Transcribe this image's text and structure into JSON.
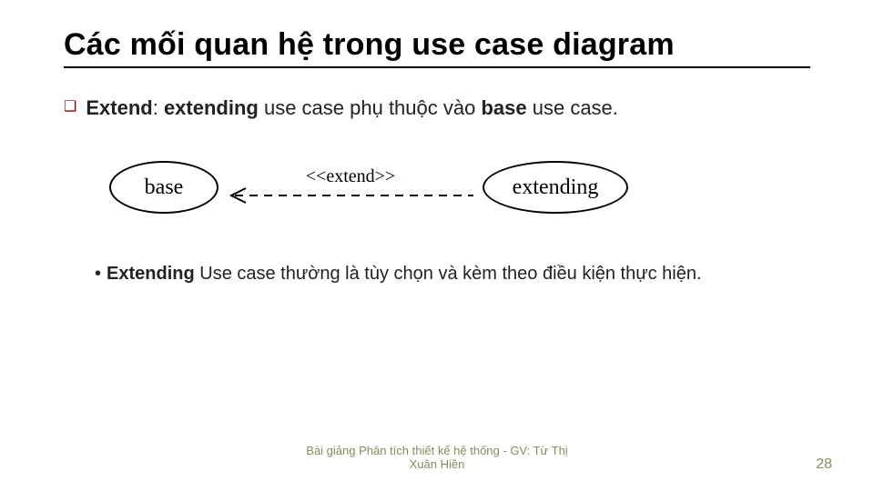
{
  "title": "Các mối quan hệ trong use case diagram",
  "bullet": {
    "marker": "❑",
    "keyword1": "Extend",
    "colon": ": ",
    "keyword2": "extending",
    "rest": " use case phụ thuộc vào ",
    "keyword3": "base",
    "tail": " use case."
  },
  "diagram": {
    "left": "base",
    "label": "<<extend>>",
    "right": "extending"
  },
  "subbullet": {
    "dot": "•",
    "keyword": "Extending",
    "rest": " Use case thường là tùy chọn và kèm theo điều kiện thực hiện."
  },
  "footer": {
    "text": "Bài giảng Phân tích thiết kế hệ thống - GV: Từ Thị Xuân Hiền",
    "page": "28"
  }
}
